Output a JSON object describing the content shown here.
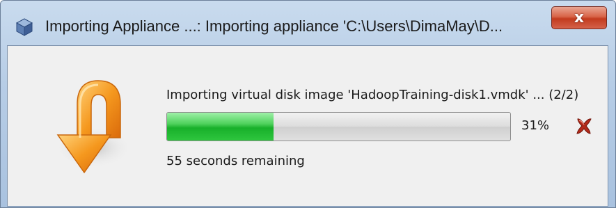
{
  "window": {
    "title": "Importing Appliance ...: Importing appliance 'C:\\Users\\DimaMay\\D...",
    "close_label": "x"
  },
  "dialog": {
    "description": "Importing virtual disk image 'HadoopTraining-disk1.vmdk' ... (2/2)",
    "progress": {
      "percent_value": 31,
      "percent_text": "31%"
    },
    "remaining_text": "55 seconds remaining"
  },
  "icons": {
    "app": "virtualbox-cube-icon",
    "main": "orange-import-arrow-icon",
    "cancel": "red-x-cancel-icon"
  },
  "colors": {
    "progress_fill": "#18b02a",
    "cancel": "#b22a1a",
    "arrow": "#f08a16",
    "close_button": "#c23b1e"
  }
}
